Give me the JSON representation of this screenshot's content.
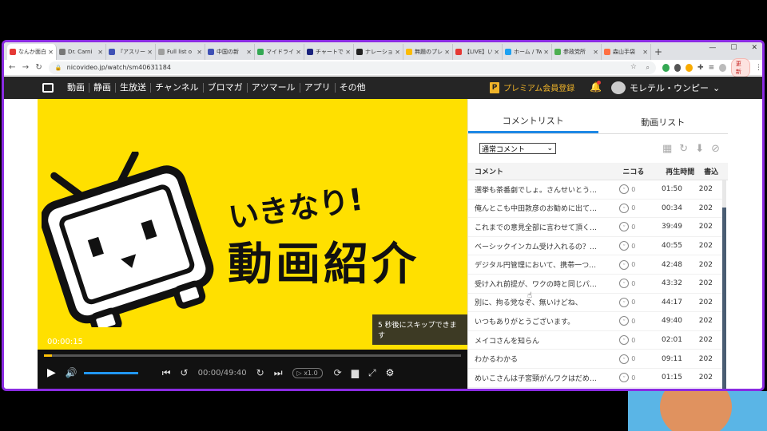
{
  "tabs": [
    {
      "title": "なんか面白",
      "color": "#e53935",
      "active": true
    },
    {
      "title": "Dr. Carni",
      "color": "#777777"
    },
    {
      "title": "『アスリー",
      "color": "#3f51b5"
    },
    {
      "title": "Full list o",
      "color": "#9e9e9e"
    },
    {
      "title": "中国の新",
      "color": "#3f51b5"
    },
    {
      "title": "マイドライ",
      "color": "#34a853"
    },
    {
      "title": "チャートで",
      "color": "#1a237e"
    },
    {
      "title": "ナレーショ",
      "color": "#222222"
    },
    {
      "title": "無題のプレ",
      "color": "#fbbc04"
    },
    {
      "title": "【LIVE】い",
      "color": "#e53935"
    },
    {
      "title": "ホーム / Tw",
      "color": "#1da1f2"
    },
    {
      "title": "参政党所",
      "color": "#4caf50"
    },
    {
      "title": "森山手袋",
      "color": "#ff7043"
    }
  ],
  "browser": {
    "url": "nicovideo.jp/watch/sm40631184",
    "update_label": "更新"
  },
  "nico": {
    "nav": [
      "動画",
      "静画",
      "生放送",
      "チャンネル",
      "ブロマガ",
      "アツマール",
      "アプリ",
      "その他"
    ],
    "premium_label": "プレミアム会員登録",
    "premium_badge": "P",
    "username": "モレテル・ウンピー"
  },
  "player": {
    "catch": "いきなり!",
    "headline": "動画紹介",
    "skip_text": "5 秒後にスキップできます",
    "ad_time": "00:00:15",
    "play_time": "00:00/49:40",
    "speed": "▷ x1.0",
    "progress": 0.02,
    "volume": 1.0
  },
  "panel": {
    "tabs": [
      "コメントリスト",
      "動画リスト"
    ],
    "filter": "通常コメント",
    "headers": {
      "comment": "コメント",
      "nicoru": "ニコる",
      "time": "再生時間",
      "posted": "書込"
    },
    "rows": [
      {
        "comment": "選挙も茶番劇でしょ。さんせいとう…",
        "nicoru": "0",
        "time": "01:50",
        "posted": "202"
      },
      {
        "comment": "俺んとこも中田敦彦のお勧めに出て…",
        "nicoru": "0",
        "time": "00:34",
        "posted": "202"
      },
      {
        "comment": "これまでの意見全部に言わせて頂く…",
        "nicoru": "0",
        "time": "39:49",
        "posted": "202"
      },
      {
        "comment": "ベーシックインカム受け入れるの？…",
        "nicoru": "0",
        "time": "40:55",
        "posted": "202"
      },
      {
        "comment": "デジタル円管理において、携帯一つ…",
        "nicoru": "0",
        "time": "42:48",
        "posted": "202"
      },
      {
        "comment": "受け入れ前提が、ワクの時と同じパ…",
        "nicoru": "0",
        "time": "43:32",
        "posted": "202"
      },
      {
        "comment": "別に、拘る党なぞ、無いけどね、",
        "nicoru": "0",
        "time": "44:17",
        "posted": "202"
      },
      {
        "comment": "いつもありがとうございます。",
        "nicoru": "0",
        "time": "49:40",
        "posted": "202"
      },
      {
        "comment": "メイコさんを知らん",
        "nicoru": "0",
        "time": "02:01",
        "posted": "202"
      },
      {
        "comment": "わかるわかる",
        "nicoru": "0",
        "time": "09:11",
        "posted": "202"
      },
      {
        "comment": "めいこさんは子宮頸がんワクはだめ…",
        "nicoru": "0",
        "time": "01:15",
        "posted": "202"
      }
    ]
  },
  "colors": {
    "accent": "#1e88e5",
    "frame": "#8a2be2",
    "nico_yellow": "#ffe000"
  }
}
